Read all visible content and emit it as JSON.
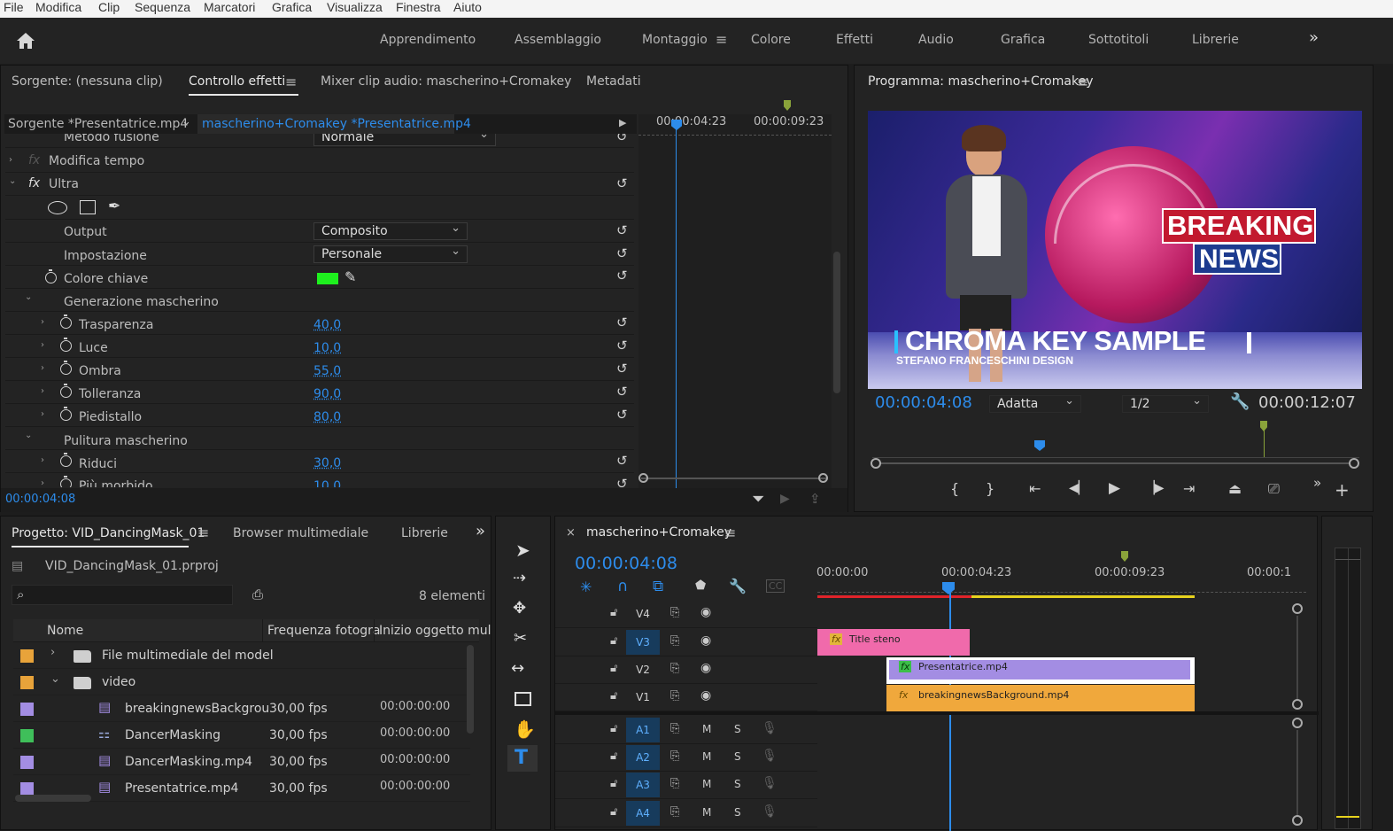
{
  "menu": [
    "File",
    "Modifica",
    "Clip",
    "Sequenza",
    "Marcatori",
    "Grafica",
    "Visualizza",
    "Finestra",
    "Aiuto"
  ],
  "workspaces": {
    "items": [
      "Apprendimento",
      "Assemblaggio",
      "Montaggio",
      "Colore",
      "Effetti",
      "Audio",
      "Grafica",
      "Sottotitoli",
      "Librerie"
    ],
    "active": "Montaggio",
    "more": "»"
  },
  "source_panel": {
    "tabs": [
      "Sorgente: (nessuna clip)",
      "Controllo effetti",
      "Mixer clip audio: mascherino+Cromakey",
      "Metadati"
    ],
    "active_tab": "Controllo effetti",
    "menu_icon": "≡",
    "source_label": "Sorgente *Presentatrice.mp4",
    "sequence_label": "mascherino+Cromakey *Presentatrice.mp4",
    "ruler_times": [
      "00:00:04:23",
      "00:00:09:23"
    ],
    "rows": {
      "metodo_fusione": {
        "label": "Metodo fusione",
        "value": "Normale"
      },
      "modifica_tempo": "Modifica tempo",
      "ultra": "Ultra",
      "output": {
        "label": "Output",
        "value": "Composito"
      },
      "impostazione": {
        "label": "Impostazione",
        "value": "Personale"
      },
      "colore_chiave": {
        "label": "Colore chiave",
        "color": "#1ef01e"
      },
      "generazione": "Generazione mascherino",
      "trasparenza": {
        "label": "Trasparenza",
        "value": "40,0"
      },
      "luce": {
        "label": "Luce",
        "value": "10,0"
      },
      "ombra": {
        "label": "Ombra",
        "value": "55,0"
      },
      "tolleranza": {
        "label": "Tolleranza",
        "value": "90,0"
      },
      "piedistallo": {
        "label": "Piedistallo",
        "value": "80,0"
      },
      "pulitura": "Pulitura mascherino",
      "riduci": {
        "label": "Riduci",
        "value": "30,0"
      },
      "morbido": {
        "label": "Più morbido",
        "value": "10,0"
      }
    },
    "timecode": "00:00:04:08"
  },
  "program": {
    "title": "Programma: mascherino+Cromakey",
    "timecode": "00:00:04:08",
    "fit": "Adatta",
    "resolution": "1/2",
    "duration": "00:00:12:07",
    "video": {
      "headline_1": "BREAKING",
      "headline_2": "NEWS",
      "lower_third": "CHROMA KEY SAMPLE",
      "credit": "STEFANO FRANCESCHINI DESIGN"
    }
  },
  "project": {
    "tabs": [
      "Progetto: VID_DancingMask_01",
      "Browser multimediale",
      "Librerie"
    ],
    "file": "VID_DancingMask_01.prproj",
    "count": "8 elementi",
    "columns": [
      "Nome",
      "Frequenza fotogra",
      "Inizio oggetto mul"
    ],
    "items": [
      {
        "name": "File multimediale del model",
        "fps": "",
        "start": "",
        "color": "#e8a33a",
        "type": "folder",
        "expanded": false
      },
      {
        "name": "video",
        "fps": "",
        "start": "",
        "color": "#e8a33a",
        "type": "folder",
        "expanded": true
      },
      {
        "name": "breakingnewsBackgrou",
        "fps": "30,00 fps",
        "start": "00:00:00:00",
        "color": "#a38de3",
        "type": "clip"
      },
      {
        "name": "DancerMasking",
        "fps": "30,00 fps",
        "start": "00:00:00:00",
        "color": "#3fbf5a",
        "type": "sequence"
      },
      {
        "name": "DancerMasking.mp4",
        "fps": "30,00 fps",
        "start": "00:00:00:00",
        "color": "#a38de3",
        "type": "clip"
      },
      {
        "name": "Presentatrice.mp4",
        "fps": "30,00 fps",
        "start": "00:00:00:00",
        "color": "#a38de3",
        "type": "clip"
      }
    ]
  },
  "timeline": {
    "title": "mascherino+Cromakey",
    "timecode": "00:00:04:08",
    "ruler": [
      "00:00:00",
      "00:00:04:23",
      "00:00:09:23",
      "00:00:1"
    ],
    "tracks": [
      "V4",
      "V3",
      "V2",
      "V1",
      "A1",
      "A2",
      "A3",
      "A4"
    ],
    "mute": "M",
    "solo": "S",
    "clips": {
      "title_steno": "Title steno",
      "presentatrice": "Presentatrice.mp4",
      "background": "breakingnewsBackground.mp4"
    },
    "fx_badge": "fx",
    "colors": {
      "accent": "#2d8ceb",
      "title_clip": "#f06aab",
      "video_clip": "#a38de3",
      "bg_clip": "#f0a83c"
    }
  }
}
